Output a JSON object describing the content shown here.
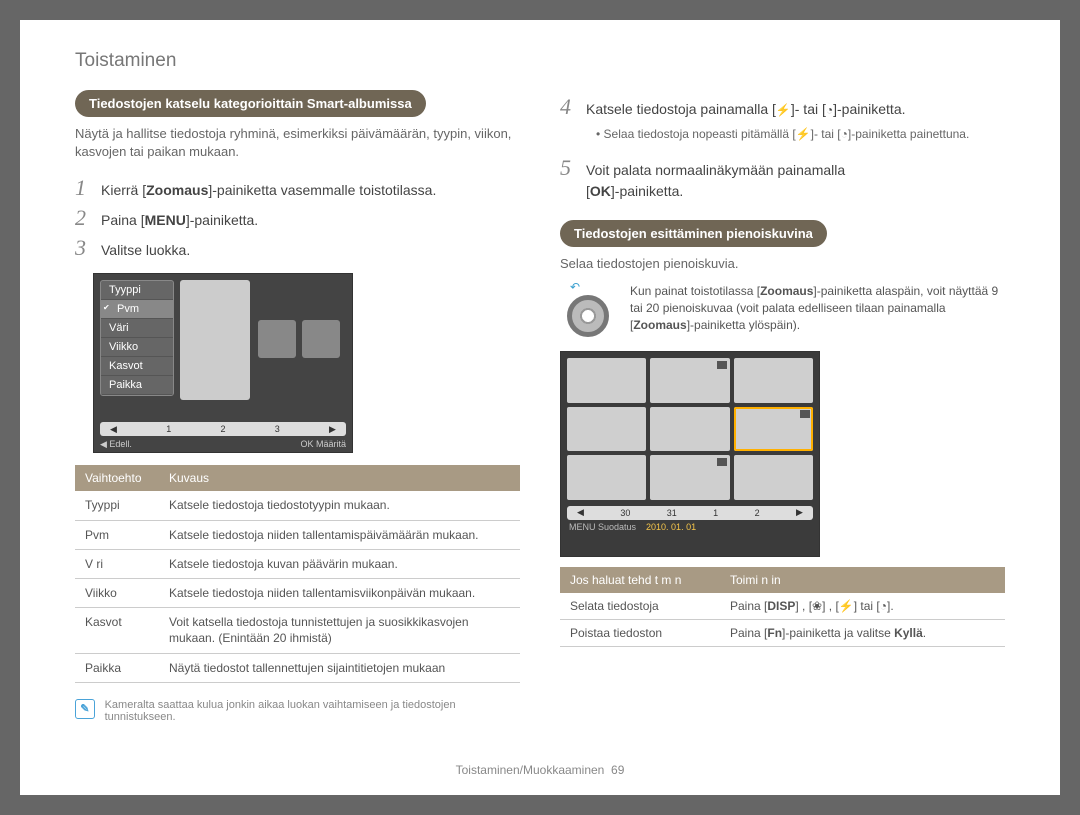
{
  "page": {
    "title": "Toistaminen",
    "breadcrumb": "Toistaminen/Muokkaaminen",
    "page_number": "69"
  },
  "left": {
    "section_title": "Tiedostojen katselu kategorioittain Smart-albumissa",
    "intro": "Näytä ja hallitse tiedostoja ryhminä, esimerkiksi päivämäärän, tyypin, viikon, kasvojen tai paikan mukaan.",
    "steps": {
      "s1_pre": "Kierrä [",
      "s1_key": "Zoomaus",
      "s1_post": "]-painiketta vasemmalle toistotilassa.",
      "s2_pre": "Paina [",
      "s2_key": "MENU",
      "s2_post": "]-painiketta.",
      "s3": "Valitse luokka."
    },
    "cat_menu": [
      "Tyyppi",
      "Pvm",
      "Väri",
      "Viikko",
      "Kasvot",
      "Paikka"
    ],
    "cat_ruler": [
      "1",
      "2",
      "3"
    ],
    "cat_footer_left": "◀  Edell.",
    "cat_footer_right": "OK  Määritä",
    "table": {
      "head_opt": "Vaihtoehto",
      "head_desc": "Kuvaus",
      "rows": [
        {
          "opt": "Tyyppi",
          "desc": "Katsele tiedostoja tiedostotyypin mukaan."
        },
        {
          "opt": "Pvm",
          "desc": "Katsele tiedostoja niiden tallentamispäivämäärän mukaan."
        },
        {
          "opt": "V ri",
          "desc": "Katsele tiedostoja kuvan päävärin mukaan."
        },
        {
          "opt": "Viikko",
          "desc": "Katsele tiedostoja niiden tallentamisviikonpäivän mukaan."
        },
        {
          "opt": "Kasvot",
          "desc": "Voit katsella tiedostoja tunnistettujen ja suosikkikasvojen mukaan. (Enintään 20 ihmistä)"
        },
        {
          "opt": "Paikka",
          "desc": "Näytä tiedostot tallennettujen sijaintitietojen mukaan"
        }
      ]
    },
    "note": "Kameralta saattaa kulua jonkin aikaa luokan vaihtamiseen ja tiedostojen tunnistukseen."
  },
  "right": {
    "step4_pre": "Katsele tiedostoja painamalla [",
    "step4_mid": "]- tai [",
    "step4_post": "]-painiketta.",
    "step4_bullet_pre": "Selaa tiedostoja nopeasti pitämällä [",
    "step4_bullet_mid": "]- tai [",
    "step4_bullet_post": "]-painiketta painettuna.",
    "step5_line1": "Voit palata normaalinäkymään painamalla",
    "step5_line2_pre": "[",
    "step5_key": "OK",
    "step5_line2_post": "]-painiketta.",
    "thumb_section_title": "Tiedostojen esittäminen pienoiskuvina",
    "thumb_intro": "Selaa tiedostojen pienoiskuvia.",
    "zoom_desc_pre": "Kun painat toistotilassa [",
    "zoom_key1": "Zoomaus",
    "zoom_desc_mid": "]-painiketta alaspäin, voit näyttää 9 tai 20 pienoiskuvaa (voit palata edelliseen tilaan painamalla [",
    "zoom_key2": "Zoomaus",
    "zoom_desc_post": "]-painiketta ylöspäin).",
    "thumb_ruler": [
      "30",
      "31",
      "1",
      "2"
    ],
    "thumb_footer_label": "MENU  Suodatus",
    "thumb_footer_date": "2010. 01. 01",
    "actions": {
      "head_left": "Jos haluat tehd t m n",
      "head_right": "Toimi n in",
      "row1_left": "Selata tiedostoja",
      "row1_right_pre": "Paina [",
      "row1_k1": "DISP",
      "row1_mid1": "] , [",
      "row1_mid2": "] , [",
      "row1_mid3": "]  tai [",
      "row1_post": "].",
      "row2_left": "Poistaa tiedoston",
      "row2_right_pre": "Paina [",
      "row2_k1": "Fn",
      "row2_right_mid": "]-painiketta ja valitse ",
      "row2_k2": "Kyllä",
      "row2_right_post": "."
    }
  }
}
